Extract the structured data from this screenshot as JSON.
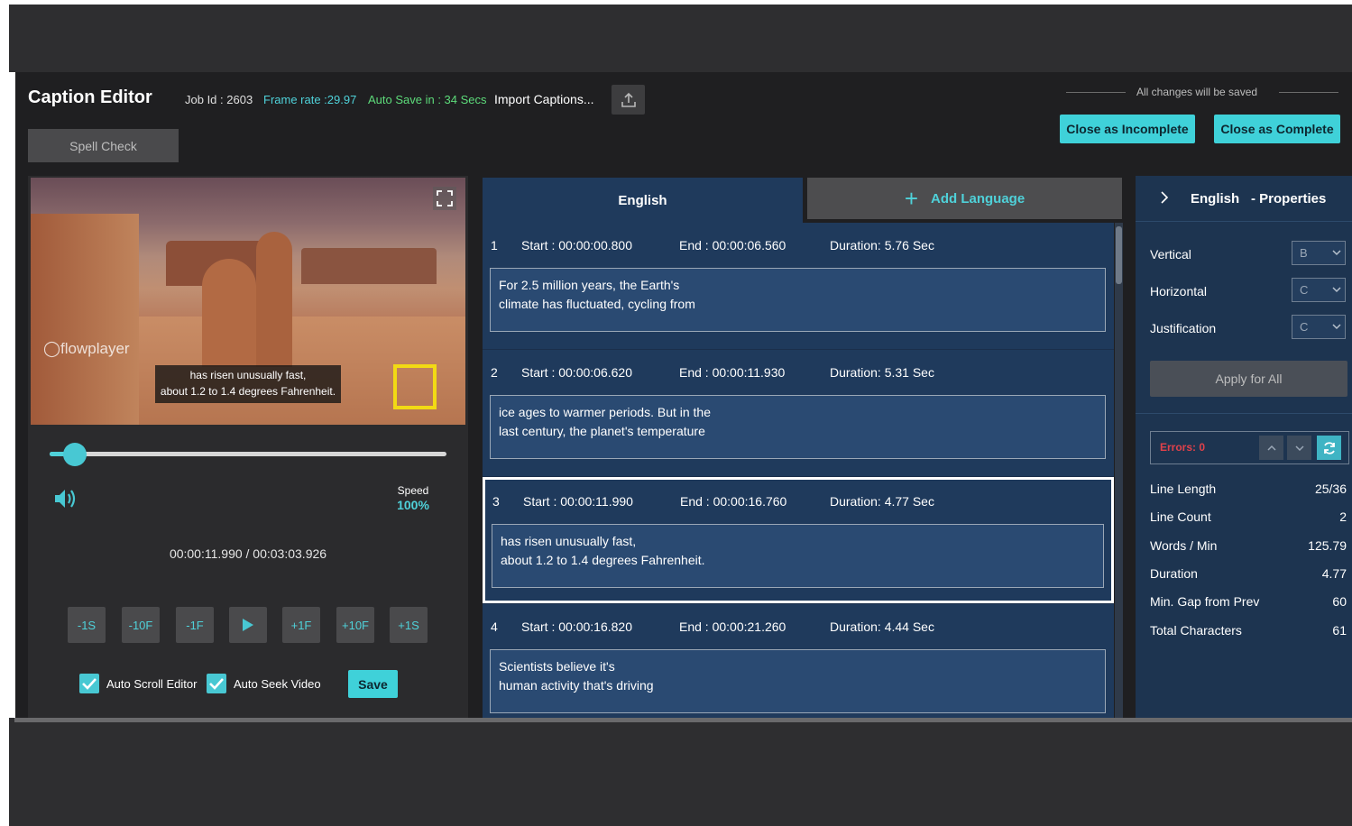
{
  "header": {
    "title": "Caption Editor",
    "job_id": "Job Id : 2603",
    "frame_rate": "Frame rate :29.97",
    "auto_save": "Auto Save in : 34 Secs",
    "import": "Import Captions...",
    "save_note": "All changes will be saved",
    "close_incomplete": "Close as Incomplete",
    "close_complete": "Close as Complete",
    "spell_check": "Spell Check"
  },
  "player": {
    "logo": "flowplayer",
    "subtitle_line1": "has risen unusually fast,",
    "subtitle_line2": "about 1.2 to 1.4 degrees Fahrenheit.",
    "progress": 0.063,
    "speed_label": "Speed",
    "speed_value": "100%",
    "timecode": "00:00:11.990 / 00:03:03.926",
    "controls": [
      "-1S",
      "-10F",
      "-1F",
      "play",
      "+1F",
      "+10F",
      "+1S"
    ],
    "auto_scroll_label": "Auto Scroll Editor",
    "auto_seek_label": "Auto Seek Video",
    "save_label": "Save"
  },
  "tabs": {
    "english": "English",
    "add_language": "Add Language"
  },
  "captions": [
    {
      "index": "1",
      "start": "Start : 00:00:00.800",
      "end": "End : 00:00:06.560",
      "duration": "Duration: 5.76 Sec",
      "line1": "For 2.5 million years, the Earth's",
      "line2": "climate has fluctuated, cycling from",
      "selected": false
    },
    {
      "index": "2",
      "start": "Start : 00:00:06.620",
      "end": "End : 00:00:11.930",
      "duration": "Duration: 5.31 Sec",
      "line1": "ice ages to warmer periods. But in the",
      "line2": "last century, the planet's temperature",
      "selected": false
    },
    {
      "index": "3",
      "start": "Start : 00:00:11.990",
      "end": "End : 00:00:16.760",
      "duration": "Duration: 4.77 Sec",
      "line1": "has risen unusually fast,",
      "line2": "about 1.2 to 1.4 degrees Fahrenheit.",
      "selected": true
    },
    {
      "index": "4",
      "start": "Start : 00:00:16.820",
      "end": "End : 00:00:21.260",
      "duration": "Duration: 4.44 Sec",
      "line1": "Scientists believe it's",
      "line2": "human activity that's driving",
      "selected": false
    }
  ],
  "properties": {
    "language": "English",
    "title": "- Properties",
    "vertical_label": "Vertical",
    "vertical_value": "B",
    "horizontal_label": "Horizontal",
    "horizontal_value": "C",
    "justification_label": "Justification",
    "justification_value": "C",
    "apply_all": "Apply for All",
    "errors": "Errors: 0",
    "stats": [
      {
        "label": "Line Length",
        "value": "25/36"
      },
      {
        "label": "Line Count",
        "value": "2"
      },
      {
        "label": "Words / Min",
        "value": "125.79"
      },
      {
        "label": "Duration",
        "value": "4.77"
      },
      {
        "label": "Min. Gap from Prev",
        "value": "60"
      },
      {
        "label": "Total Characters",
        "value": "61"
      }
    ]
  },
  "colors": {
    "accent": "#3fd1d9",
    "caption_bg": "#1f3a5c",
    "error": "#e0414a"
  }
}
